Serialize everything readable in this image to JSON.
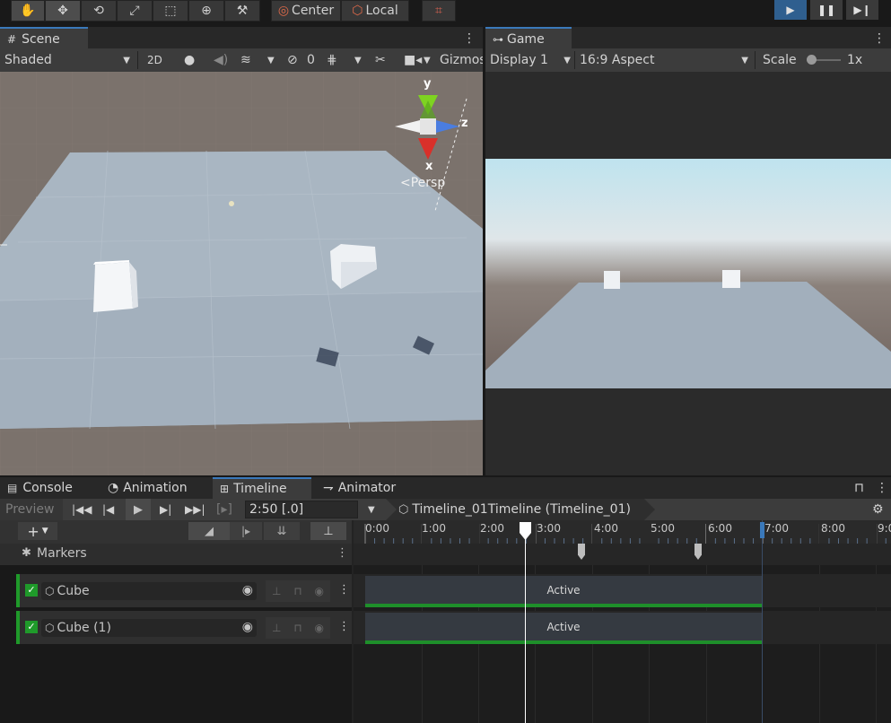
{
  "toolbar": {
    "tools": [
      "hand-tool",
      "move-tool",
      "rotate-tool",
      "scale-tool",
      "rect-tool",
      "transform-tool",
      "custom-tool"
    ],
    "pivot_label": "Center",
    "space_label": "Local",
    "play_controls": [
      "play",
      "pause",
      "step"
    ]
  },
  "scene": {
    "tab_label": "Scene",
    "shading_mode": "Shaded",
    "mode_2d": "2D",
    "hidden_count": "0",
    "gizmos_label": "Gizmos",
    "axis_y": "y",
    "axis_z": "z",
    "axis_x": "x",
    "persp_label": "Persp"
  },
  "game": {
    "tab_label": "Game",
    "display": "Display 1",
    "aspect": "16:9 Aspect",
    "scale_label": "Scale",
    "scale_value": "1x"
  },
  "bottom_tabs": {
    "console": "Console",
    "animation": "Animation",
    "timeline": "Timeline",
    "animator": "Animator"
  },
  "timeline": {
    "preview_label": "Preview",
    "time_field": "2:50 [.0]",
    "asset_label": "Timeline_01Timeline (Timeline_01)",
    "ruler_ticks": [
      "0:00",
      "1:00",
      "2:00",
      "3:00",
      "4:00",
      "5:00",
      "6:00",
      "7:00",
      "8:00",
      "9:0"
    ],
    "markers_label": "Markers",
    "tracks": [
      {
        "name": "Cube",
        "clip_label": "Active"
      },
      {
        "name": "Cube (1)",
        "clip_label": "Active"
      }
    ]
  },
  "colors": {
    "accent_blue": "#3a79bb",
    "track_green": "#1f9a2a",
    "clip_bar": "#1e8f2a"
  }
}
